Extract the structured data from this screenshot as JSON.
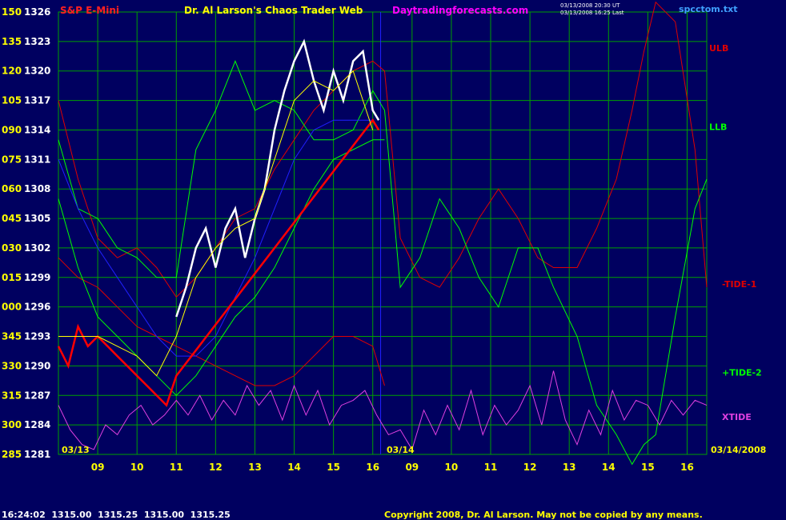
{
  "header": {
    "instrument": "S&P E-Mini",
    "title": "Dr. Al Larson's Chaos Trader Web",
    "site": "Daytradingforecasts.com",
    "stamp_line1": "03/13/2008 20:30 UT",
    "stamp_line2": "03/13/2008 16:25 Last",
    "file": "spcctom.txt"
  },
  "footer": {
    "quote": "16:24:02  1315.00  1315.25  1315.00  1315.25",
    "copyright": "Copyright 2008, Dr. Al Larson. May not be copied by any means."
  },
  "date_labels": {
    "left": "03/13",
    "mid": "03/14",
    "right": "03/14/2008"
  },
  "colors": {
    "background": "#000060",
    "grid": "#00a000",
    "price_axis": "#ffffff",
    "angle_axis": "#ffff00",
    "instrument": "#ff2020",
    "title": "#ffff00",
    "site": "#ff00ff",
    "stamp": "#ffffff",
    "file": "#40a0ff",
    "copyright": "#ffff00"
  },
  "chart_data": {
    "type": "line",
    "y_axis_price": [
      1326,
      1323,
      1320,
      1317,
      1314,
      1311,
      1308,
      1305,
      1302,
      1299,
      1296,
      1293,
      1290,
      1287,
      1284,
      1281
    ],
    "y_axis_angle": [
      "150",
      "135",
      "120",
      "105",
      "090",
      "075",
      "060",
      "045",
      "030",
      "015",
      "000",
      "345",
      "330",
      "315",
      "300",
      "285"
    ],
    "ylim": [
      1281,
      1326
    ],
    "x_ticks": [
      "09",
      "10",
      "11",
      "12",
      "13",
      "14",
      "15",
      "16",
      "09",
      "10",
      "11",
      "12",
      "13",
      "14",
      "15",
      "16"
    ],
    "xlim": [
      8,
      24.5
    ],
    "series": [
      {
        "name": "ULB",
        "color": "#e00000",
        "x": [
          8,
          8.5,
          9,
          9.5,
          10,
          10.5,
          11,
          11.5,
          12,
          12.5,
          13,
          13.5,
          14,
          14.5,
          15,
          15.5,
          16,
          16.3,
          16.7,
          17.2,
          17.7,
          18.2,
          18.7,
          19.2,
          19.7,
          20.2,
          20.6,
          21.2,
          21.7,
          22.2,
          22.6,
          22.9,
          23.2,
          23.7,
          24.2,
          24.5
        ],
        "values": [
          1317,
          1309,
          1303,
          1301,
          1302,
          1300,
          1297,
          1299,
          1302,
          1305,
          1306,
          1310,
          1313,
          1316,
          1318,
          1320,
          1321,
          1320,
          1303,
          1299,
          1298,
          1301,
          1305,
          1308,
          1305,
          1301,
          1300,
          1300,
          1304,
          1309,
          1316,
          1322,
          1327,
          1325,
          1312,
          1298
        ]
      },
      {
        "name": "LLB",
        "color": "#00ff00",
        "x": [
          8,
          8.5,
          9,
          9.5,
          10,
          10.5,
          11,
          11.5,
          12,
          12.5,
          13,
          13.5,
          14,
          14.5,
          15,
          15.5,
          16,
          16.3,
          16.7,
          17.2,
          17.7,
          18.2,
          18.7,
          19.2,
          19.7,
          20.2,
          20.6,
          21.2,
          21.7,
          22.2,
          22.6,
          22.9,
          23.2,
          23.7,
          24.2,
          24.5
        ],
        "values": [
          1313,
          1306,
          1305,
          1302,
          1301,
          1299,
          1299,
          1312,
          1316,
          1321,
          1316,
          1317,
          1316,
          1313,
          1313,
          1314,
          1318,
          1316,
          1298,
          1301,
          1307,
          1304,
          1299,
          1296,
          1302,
          1302,
          1298,
          1293,
          1286,
          1283,
          1280,
          1282,
          1283,
          1295,
          1306,
          1309
        ]
      },
      {
        "name": "-TIDE-1",
        "color": "#e00000",
        "x": [
          8,
          8.5,
          9,
          9.5,
          10,
          10.5,
          11,
          11.5,
          12,
          12.5,
          13,
          13.5,
          14,
          14.5,
          15,
          15.5,
          16,
          16.3
        ],
        "values": [
          1301,
          1299,
          1298,
          1296,
          1294,
          1293,
          1292,
          1291,
          1290,
          1289,
          1288,
          1288,
          1289,
          1291,
          1293,
          1293,
          1292,
          1288
        ]
      },
      {
        "name": "+TIDE-2",
        "color": "#00ff00",
        "x": [
          8,
          8.5,
          9,
          9.5,
          10,
          10.5,
          11,
          11.5,
          12,
          12.5,
          13,
          13.5,
          14,
          14.5,
          15,
          15.5,
          16,
          16.3
        ],
        "values": [
          1307,
          1300,
          1295,
          1293,
          1291,
          1289,
          1287,
          1289,
          1292,
          1295,
          1297,
          1300,
          1304,
          1308,
          1311,
          1312,
          1313,
          1313
        ]
      },
      {
        "name": "XTIDE",
        "color": "#e040e0",
        "x": [
          8,
          8.3,
          8.6,
          8.9,
          9.2,
          9.5,
          9.8,
          10.1,
          10.4,
          10.7,
          11,
          11.3,
          11.6,
          11.9,
          12.2,
          12.5,
          12.8,
          13.1,
          13.4,
          13.7,
          14,
          14.3,
          14.6,
          14.9,
          15.2,
          15.5,
          15.8,
          16.1,
          16.4,
          16.7,
          17,
          17.3,
          17.6,
          17.9,
          18.2,
          18.5,
          18.8,
          19.1,
          19.4,
          19.7,
          20,
          20.3,
          20.6,
          20.9,
          21.2,
          21.5,
          21.8,
          22.1,
          22.4,
          22.7,
          23,
          23.3,
          23.6,
          23.9,
          24.2,
          24.5
        ],
        "values": [
          1286,
          1283.5,
          1282,
          1281.5,
          1284,
          1283,
          1285,
          1286,
          1284,
          1285,
          1286.5,
          1285,
          1287,
          1284.5,
          1286.5,
          1285,
          1288,
          1286,
          1287.5,
          1284.5,
          1288,
          1285,
          1287.5,
          1284,
          1286,
          1286.5,
          1287.5,
          1285,
          1283,
          1283.5,
          1281.5,
          1285.5,
          1283,
          1286,
          1283.5,
          1287.5,
          1283,
          1286,
          1284,
          1285.5,
          1288,
          1284,
          1289.5,
          1284.5,
          1282,
          1285.5,
          1283,
          1287.5,
          1284.5,
          1286.5,
          1286,
          1284,
          1286.5,
          1285,
          1286.5,
          1286
        ]
      },
      {
        "name": "",
        "color": "#2020ff",
        "x": [
          8,
          8.5,
          9,
          9.5,
          10,
          10.5,
          11,
          11.5,
          12,
          12.5,
          13,
          13.5,
          14,
          14.5,
          15,
          15.5,
          16
        ],
        "values": [
          1311,
          1306,
          1302,
          1299,
          1296,
          1293,
          1291,
          1291,
          1293,
          1297,
          1301,
          1306,
          1311,
          1314,
          1315,
          1315,
          1315
        ]
      },
      {
        "name": "",
        "color": "#ffffff",
        "x": [
          11,
          11.25,
          11.5,
          11.75,
          12,
          12.25,
          12.5,
          12.75,
          13,
          13.25,
          13.5,
          13.75,
          14,
          14.25,
          14.5,
          14.75,
          15,
          15.25,
          15.5,
          15.75,
          16,
          16.15
        ],
        "values": [
          1295,
          1298,
          1302,
          1304,
          1300,
          1304,
          1306,
          1301,
          1305,
          1308,
          1314,
          1318,
          1321,
          1323,
          1319,
          1316,
          1320,
          1317,
          1321,
          1322,
          1316,
          1315
        ]
      },
      {
        "name": "",
        "color": "#ff0000",
        "x": [
          8,
          8.25,
          8.5,
          8.75,
          9,
          9.25,
          9.5,
          9.75,
          10,
          10.25,
          10.5,
          10.75,
          11,
          16,
          16.15
        ],
        "values": [
          1292,
          1290,
          1294,
          1292,
          1293,
          1292,
          1291,
          1290,
          1289,
          1288,
          1287,
          1286,
          1289,
          1315,
          1314
        ]
      },
      {
        "name": "",
        "color": "#ffff00",
        "x": [
          8,
          8.5,
          9,
          9.5,
          10,
          10.5,
          11,
          11.5,
          12,
          12.5,
          13,
          13.5,
          14,
          14.5,
          15,
          15.5,
          16
        ],
        "values": [
          1293,
          1293,
          1293,
          1292,
          1291,
          1289,
          1293,
          1299,
          1302,
          1304,
          1305,
          1311,
          1317,
          1319,
          1318,
          1320,
          1314
        ]
      }
    ]
  }
}
